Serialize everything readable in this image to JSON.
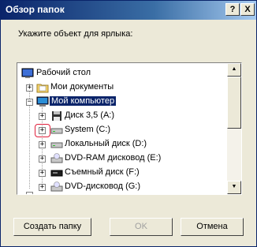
{
  "window": {
    "title": "Обзор папок",
    "help": "?",
    "close": "X"
  },
  "prompt": "Укажите объект для ярлыка:",
  "tree": [
    {
      "label": "Рабочий стол",
      "expander": "",
      "icon": "desktop-icon"
    },
    {
      "label": "Мои документы",
      "expander": "+",
      "icon": "folder-icon"
    },
    {
      "label": "Мой компьютер",
      "expander": "−",
      "icon": "computer-icon",
      "selected": true
    },
    {
      "label": "Диск 3,5 (A:)",
      "expander": "+",
      "icon": "floppy-icon"
    },
    {
      "label": "System (C:)",
      "expander": "+",
      "icon": "hard-drive-icon"
    },
    {
      "label": "Локальный диск (D:)",
      "expander": "+",
      "icon": "hard-drive-icon"
    },
    {
      "label": "DVD-RAM дисковод (E:)",
      "expander": "+",
      "icon": "dvd-drive-icon"
    },
    {
      "label": "Съемный диск (F:)",
      "expander": "+",
      "icon": "removable-drive-icon"
    },
    {
      "label": "DVD-дисковод (G:)",
      "expander": "+",
      "icon": "dvd-drive-icon"
    }
  ],
  "buttons": {
    "new_folder": "Создать папку",
    "ok": "OK",
    "cancel": "Отмена"
  },
  "colors": {
    "titlebar": "#0a246a",
    "selection": "#0a246a",
    "highlight": "#e0203c"
  }
}
